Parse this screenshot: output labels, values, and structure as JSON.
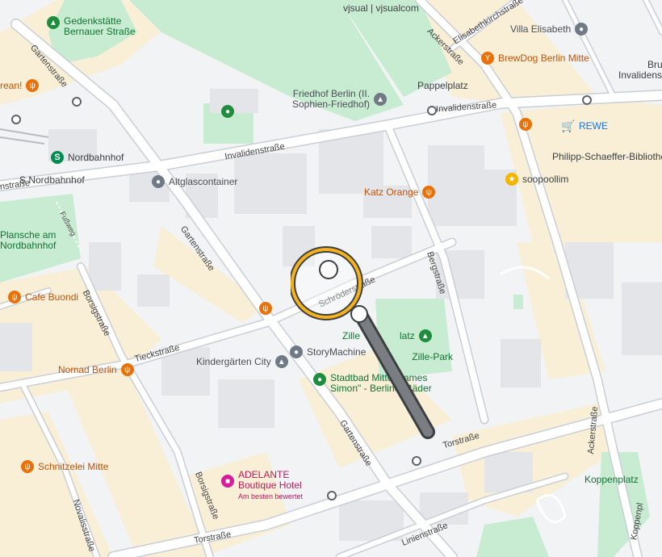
{
  "map": {
    "colors": {
      "background": "#f2f2f0",
      "block": "#e8eaed",
      "road": "#ffffff",
      "park": "#c8ecd2",
      "building_warm": "#f8efd6",
      "road_casing": "#c9ced6"
    }
  },
  "pois": {
    "gedenkstaette": {
      "line1": "Gedenkstätte",
      "line2": "Bernauer Straße",
      "icon": "tree-icon"
    },
    "vjsual": {
      "label": "vjsual | vjsualcom"
    },
    "villa_elisabeth": {
      "label": "Villa Elisabeth",
      "icon": "landmark-icon"
    },
    "brewdog": {
      "label": "BrewDog Berlin Mitte",
      "icon": "cocktail-icon"
    },
    "friedhof": {
      "line1": "Friedhof Berlin (II.",
      "line2": "Sophien-Friedhof)",
      "icon": "memorial-icon"
    },
    "pappelplatz": {
      "label": "Pappelplatz"
    },
    "rewe": {
      "label": "REWE",
      "icon": "shopping-cart-icon"
    },
    "nordbahnhof": {
      "label": "Nordbahnhof",
      "icon": "s-bahn-icon"
    },
    "s_nordbahnhof": {
      "label": "S Nordbahnhof"
    },
    "altglas": {
      "label": "Altglascontainer",
      "icon": "recycling-icon"
    },
    "philipp": {
      "label": "Philipp-Schaeffer-Bibliothek"
    },
    "katz": {
      "label": "Katz Orange",
      "icon": "restaurant-icon"
    },
    "soopoollim": {
      "label": "soopoollim",
      "icon": "star-icon"
    },
    "plansche": {
      "line1": "Plansche am",
      "line2": "Nordbahnhof"
    },
    "cafe_buondi": {
      "label": "Cafe Buondi",
      "icon": "restaurant-icon"
    },
    "storymachine": {
      "label": "StoryMachine",
      "icon": "building-icon"
    },
    "kindergaerten": {
      "label": "Kindergärten City",
      "icon": "school-icon"
    },
    "nomad": {
      "label": "Nomad Berlin",
      "icon": "restaurant-icon"
    },
    "stadtbad": {
      "line1": "Stadtbad Mitte \"James",
      "line2": "Simon\" - Berliner Bäder",
      "icon": "pool-icon"
    },
    "zille_park": {
      "label": "Zille-Park",
      "line_partial": "Zille",
      "line_partial2": "latz",
      "line_partial3": "He"
    },
    "schnitzelei": {
      "label": "Schnitzelei Mitte",
      "icon": "restaurant-icon"
    },
    "adelante": {
      "line1": "ADELANTE",
      "line2": "Boutique Hotel",
      "sub": "Am besten bewertet",
      "icon": "hotel-icon"
    },
    "koppenplatz": {
      "label": "Koppenplatz"
    },
    "bru": {
      "line1": "Bru",
      "line2": "Invalidenstra"
    },
    "brean": {
      "label": "rean!"
    }
  },
  "streets": {
    "gartenstrasse_top": "Gartenstraße",
    "invalidenstrasse_mid": "Invalidenstraße",
    "invalidenstrasse_left": "Invalidenstraße",
    "invalidenstrasse_right": "Invalidenstraße",
    "ackerstrasse": "Ackerstraße",
    "elisabethkirchstrasse": "Elisabethkirchstraße",
    "gartenstrasse_mid": "Gartenstraße",
    "gartenstrasse_low": "Gartenstraße",
    "schroederstrasse": "Schröderstraße",
    "bergstrasse": "Bergstraße",
    "borsigstrasse_left": "Borsigstraße",
    "borsigstrasse_low": "Borsigstraße",
    "tieckstrasse": "Tieckstraße",
    "torstrasse_mid": "Torstraße",
    "torstrasse_low": "Torstraße",
    "ackerstrasse_low": "Ackerstraße",
    "novalisstrasse": "Novalisstraße",
    "linienstrasse": "Linienstraße",
    "koppenplatz_street": "Koppenpl",
    "fussweg": "Fußweg"
  }
}
